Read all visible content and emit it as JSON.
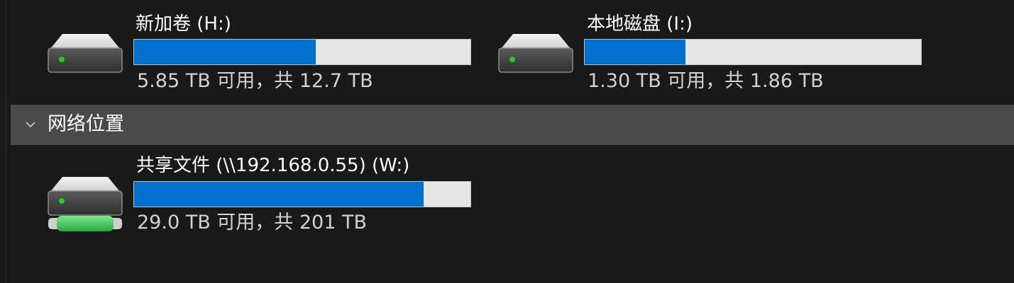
{
  "drives": [
    {
      "name": "新加卷 (H:)",
      "info": "5.85 TB 可用，共 12.7 TB",
      "used_fraction": 0.54,
      "icon": "hard-drive-icon"
    },
    {
      "name": "本地磁盘 (I:)",
      "info": "1.30 TB 可用，共 1.86 TB",
      "used_fraction": 0.3,
      "icon": "hard-drive-icon"
    }
  ],
  "network_section": {
    "title": "网络位置",
    "icon": "chevron-down-icon",
    "expanded": true
  },
  "network_drives": [
    {
      "name": "共享文件 (\\\\192.168.0.55) (W:)",
      "info": "29.0 TB 可用，共 201 TB",
      "used_fraction": 0.86,
      "icon": "network-drive-icon"
    }
  ],
  "colors": {
    "background": "#191919",
    "bar_fill": "#0070cc",
    "bar_track": "#e6e6e6",
    "section_header": "#4a4a4a",
    "led": "#22cc22",
    "network_connector": "#3ec45a"
  }
}
